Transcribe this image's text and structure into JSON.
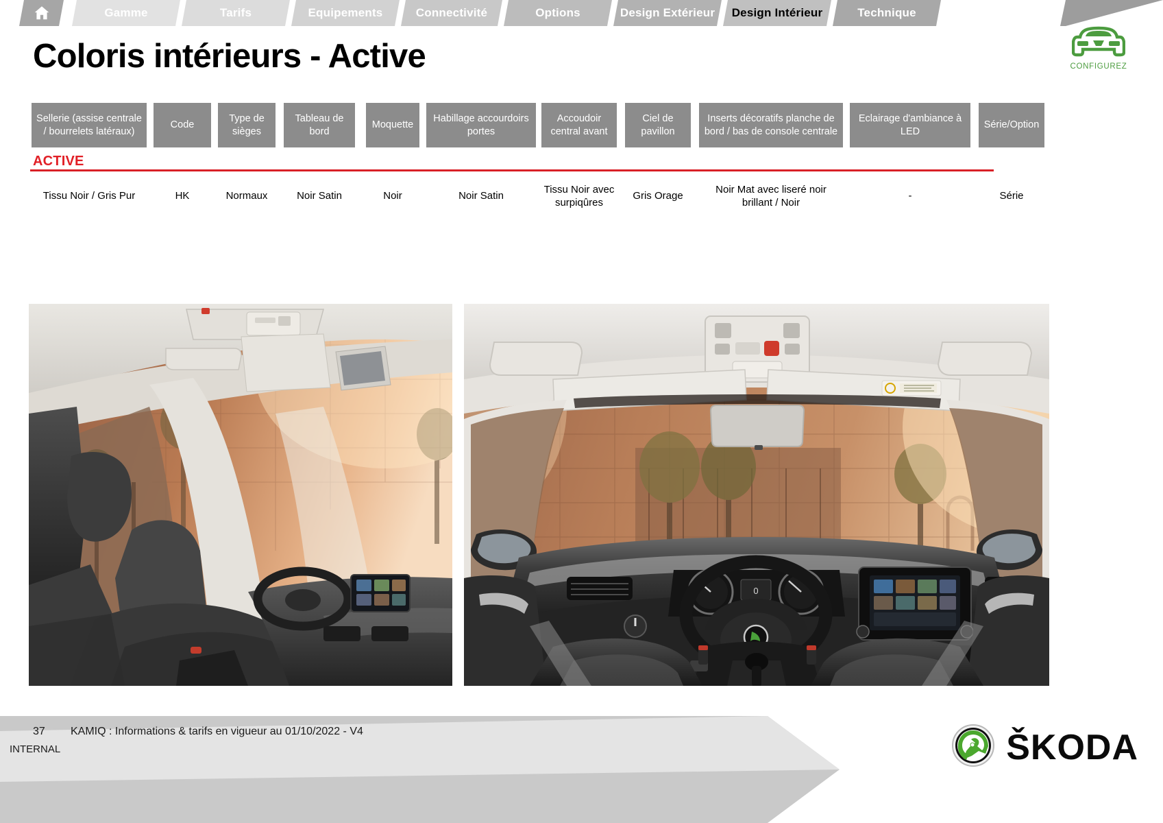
{
  "nav": {
    "home_icon": "home-icon",
    "tabs": [
      {
        "label": "Gamme",
        "active": false,
        "bg": "#e2e2e2"
      },
      {
        "label": "Tarifs",
        "active": false,
        "bg": "#dcdcdc"
      },
      {
        "label": "Equipements",
        "active": false,
        "bg": "#d2d2d2"
      },
      {
        "label": "Connectivité",
        "active": false,
        "bg": "#c8c8c8"
      },
      {
        "label": "Options",
        "active": false,
        "bg": "#bcbcbc"
      },
      {
        "label": "Design Extérieur",
        "active": false,
        "bg": "#b2b2b2"
      },
      {
        "label": "Design Intérieur",
        "active": true,
        "bg": "#c0c0c0"
      },
      {
        "label": "Technique",
        "active": false,
        "bg": "#a8a8a8"
      }
    ]
  },
  "header": {
    "title": "Coloris intérieurs - Active"
  },
  "configurez": {
    "icon": "car-front-icon",
    "label": "CONFIGUREZ",
    "color": "#4c9c3f"
  },
  "table": {
    "columns": [
      "Sellerie (assise centrale / bourrelets latéraux)",
      "Code",
      "Type de sièges",
      "Tableau de bord",
      "Moquette",
      "Habillage accourdoirs portes",
      "Accoudoir central avant",
      "Ciel de pavillon",
      "Inserts décoratifs planche de bord / bas de console centrale",
      "Eclairage d'ambiance à LED",
      "Série/Option"
    ],
    "group_label": "ACTIVE",
    "group_color": "#e11f26",
    "rows": [
      [
        "Tissu Noir / Gris Pur",
        "HK",
        "Normaux",
        "Noir Satin",
        "Noir",
        "Noir Satin",
        "Tissu Noir avec surpiqûres",
        "Gris Orage",
        "Noir Mat avec liseré noir brillant / Noir",
        "-",
        "Série"
      ]
    ]
  },
  "photos": [
    {
      "name": "interior-photo-front-seats",
      "caption": ""
    },
    {
      "name": "interior-photo-dashboard",
      "caption": ""
    }
  ],
  "footer": {
    "page_number": "37",
    "document_text": "KAMIQ : Informations & tarifs en vigueur au 01/10/2022 - V4",
    "classification": "INTERNAL",
    "brand": "ŠKODA"
  }
}
